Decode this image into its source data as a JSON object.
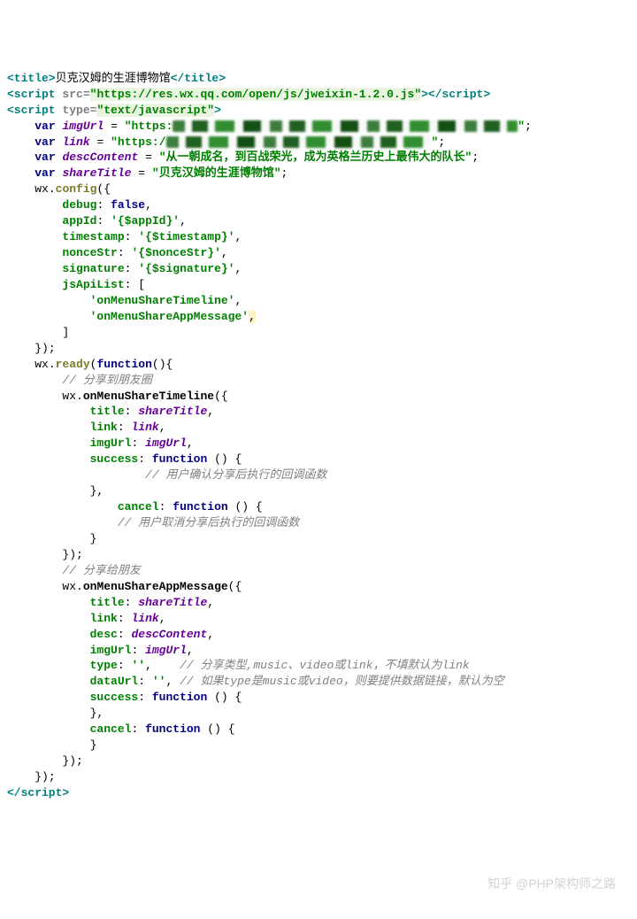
{
  "title_text": "贝克汉姆的生涯博物馆",
  "script_src": "https://res.wx.qq.com/open/js/jweixin-1.2.0.js",
  "script_type": "text/javascript",
  "vars": {
    "imgUrl_prefix": "\"https:",
    "imgUrl_suffix": "\"",
    "link_prefix": "\"https:/",
    "link_suffix": "\"",
    "descContent": "\"从一朝成名，到百战荣光，成为英格兰历史上最伟大的队长\"",
    "shareTitle": "\"贝克汉姆的生涯博物馆\""
  },
  "config": {
    "fn": "config",
    "debug_key": "debug",
    "debug_val": "false",
    "appId_key": "appId",
    "appId_val": "'{$appId}'",
    "timestamp_key": "timestamp",
    "timestamp_val": "'{$timestamp}'",
    "nonceStr_key": "nonceStr",
    "nonceStr_val": "'{$nonceStr}'",
    "signature_key": "signature",
    "signature_val": "'{$signature}'",
    "jsApiList_key": "jsApiList",
    "jsApiList": [
      "'onMenuShareTimeline'",
      "'onMenuShareAppMessage'"
    ]
  },
  "ready": {
    "fn": "ready",
    "timeline_comment": "// 分享到朋友圈",
    "timeline_fn": "onMenuShareTimeline",
    "timeline": {
      "title": "title",
      "title_v": "shareTitle",
      "link": "link",
      "link_v": "link",
      "imgUrl": "imgUrl",
      "imgUrl_v": "imgUrl",
      "success": "success",
      "success_comment": "// 用户确认分享后执行的回调函数",
      "cancel": "cancel",
      "cancel_comment": "// 用户取消分享后执行的回调函数"
    },
    "appmsg_comment": "// 分享给朋友",
    "appmsg_fn": "onMenuShareAppMessage",
    "appmsg": {
      "title": "title",
      "title_v": "shareTitle",
      "link": "link",
      "link_v": "link",
      "desc": "desc",
      "desc_v": "descContent",
      "imgUrl": "imgUrl",
      "imgUrl_v": "imgUrl",
      "type": "type",
      "type_v": "''",
      "type_comment": "// 分享类型,music、video或link，不填默认为link",
      "dataUrl": "dataUrl",
      "dataUrl_v": "''",
      "dataUrl_comment": "// 如果type是music或video，则要提供数据链接，默认为空",
      "success": "success",
      "cancel": "cancel"
    }
  },
  "watermark": "知乎 @PHP架构师之路"
}
